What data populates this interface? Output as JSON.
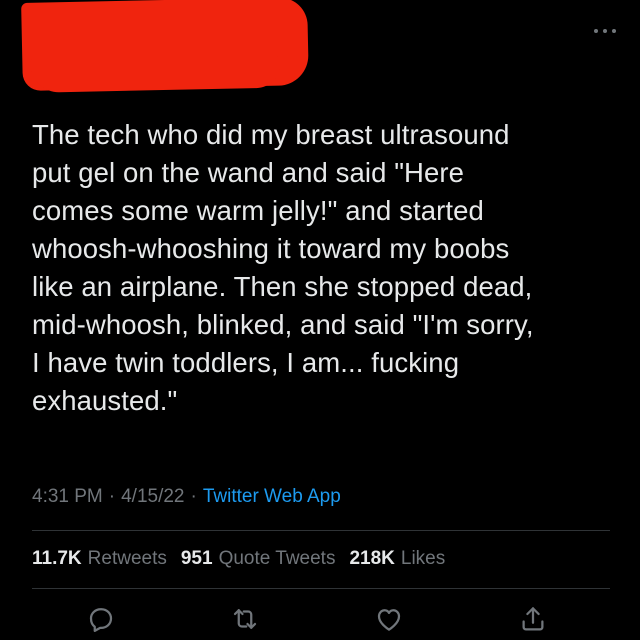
{
  "header": {
    "more_icon": "more-horizontal-icon"
  },
  "tweet": {
    "text": "The tech who did my breast ultrasound\nput gel on the wand and said \"Here\ncomes some warm jelly!\" and started\nwhoosh-whooshing it toward my boobs\nlike an airplane. Then she stopped dead,\nmid-whoosh, blinked, and said \"I'm sorry,\nI have twin toddlers, I am... fucking\nexhausted.\"",
    "time": "4:31 PM",
    "separator": "·",
    "date": "4/15/22",
    "source": "Twitter Web App"
  },
  "stats": {
    "retweets_count": "11.7K",
    "retweets_label": "Retweets",
    "quotes_count": "951",
    "quotes_label": "Quote Tweets",
    "likes_count": "218K",
    "likes_label": "Likes"
  },
  "actions": [
    "reply-icon",
    "retweet-icon",
    "like-icon",
    "share-icon"
  ],
  "colors": {
    "background": "#000000",
    "text": "#e7e9ea",
    "secondary": "#71767b",
    "link": "#1d9bf0",
    "redaction": "#f0240e",
    "divider": "#2f3336"
  }
}
